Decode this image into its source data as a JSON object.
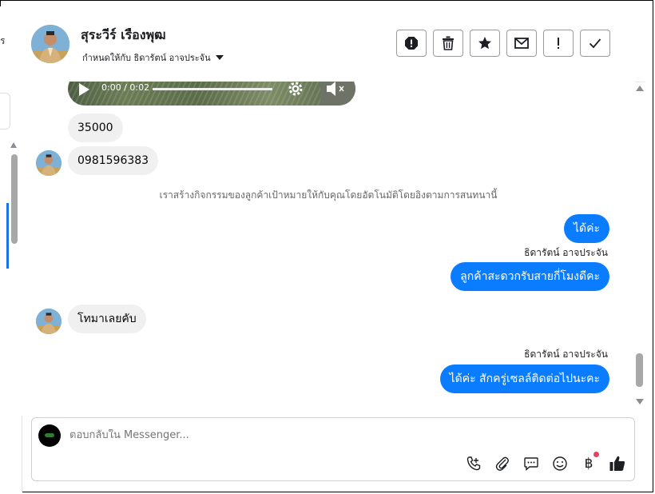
{
  "header": {
    "contact_name": "สุระวีร์ เรืองพุฒ",
    "assigned_label": "กำหนดให้กับ ธิดารัตน์ อาจประจัน",
    "actions": [
      {
        "name": "spam-button",
        "label": "spam"
      },
      {
        "name": "delete-button",
        "label": "delete"
      },
      {
        "name": "star-button",
        "label": "star"
      },
      {
        "name": "mark-unread-button",
        "label": "mark unread"
      },
      {
        "name": "follow-up-button",
        "label": "follow up"
      },
      {
        "name": "mark-done-button",
        "label": "done"
      }
    ]
  },
  "audio": {
    "time": "0:00 / 0:02"
  },
  "messages": {
    "m1": "35000",
    "m2": "0981596383",
    "system_note": "เราสร้างกิจกรรมของลูกค้าเป้าหมายให้กับคุณโดยอัตโนมัติโดยอิงตามการสนทนานี้",
    "m3": "ได้ค่ะ",
    "sender_1": "ธิดารัตน์ อาจประจัน",
    "m4": "ลูกค้าสะดวกรับสายกี่โมงดีคะ",
    "m5": "โทมาเลยคับ",
    "sender_2": "ธิดารัตน์ อาจประจัน",
    "m6": "ได้ค่ะ สักครู่เซลล์ติดต่อไปนะคะ"
  },
  "composer": {
    "placeholder": "ตอบกลับใน Messenger..."
  },
  "icons": {
    "left_strip_glyph": "ร",
    "currency_glyph": "฿"
  },
  "colors": {
    "outgoing_bubble": "#0a7cff",
    "incoming_bubble": "#f0f0f0",
    "accent_dot": "#e4405f"
  }
}
